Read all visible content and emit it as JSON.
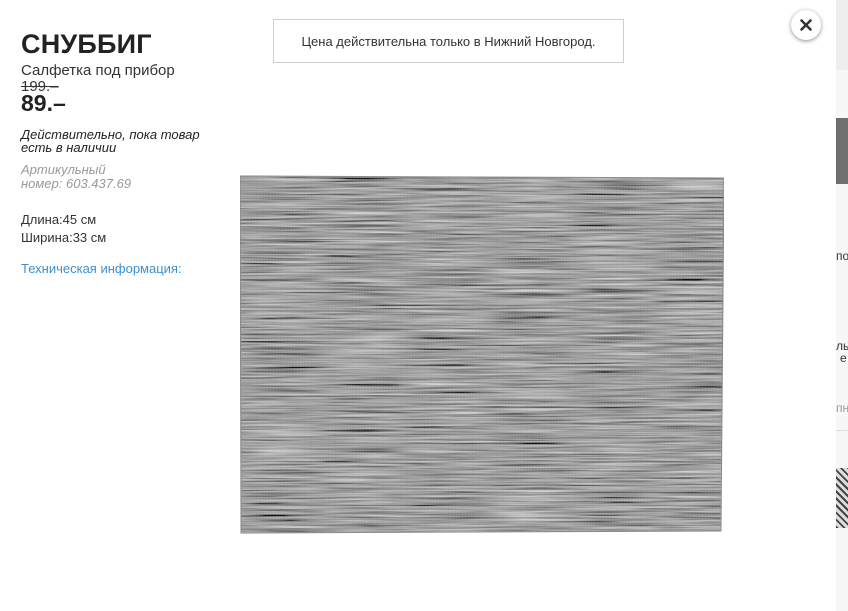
{
  "product": {
    "name": "СНУББИГ",
    "description": "Салфетка под прибор",
    "old_price": "199.–",
    "new_price": "89.–",
    "validity_line1": "Действительно, пока товар",
    "validity_line2": "есть в наличии",
    "article_label": "Артикульный",
    "article_prefix": "номер:",
    "article_number": "603.437.69",
    "length": "Длина:45 см",
    "width": "Ширина:33 см",
    "tech_info_link": "Техническая информация:"
  },
  "notice": {
    "text": "Цена действительна только в Нижний Новгород."
  },
  "close": {
    "icon": "close-icon"
  },
  "image": {
    "icon": "placemat-image",
    "base_color": "#6a6a6a"
  },
  "background_fragments": {
    "frag1": "по",
    "frag2": "ль",
    "frag3": "е",
    "frag4": "пн"
  },
  "colors": {
    "link": "#3d8fd1",
    "muted": "#999999",
    "text": "#222222"
  }
}
